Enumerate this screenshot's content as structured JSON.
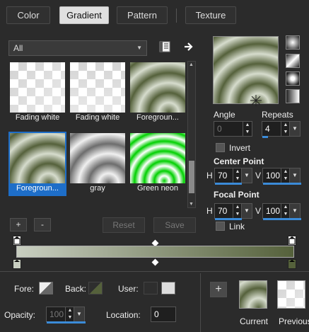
{
  "tabs": [
    {
      "label": "Color"
    },
    {
      "label": "Gradient"
    },
    {
      "label": "Pattern"
    },
    {
      "label": "Texture"
    }
  ],
  "filter": {
    "selected": "All"
  },
  "gallery": [
    {
      "label": "Fading white"
    },
    {
      "label": "Fading white"
    },
    {
      "label": "Foregroun..."
    },
    {
      "label": "Foregroun..."
    },
    {
      "label": "gray"
    },
    {
      "label": "Green neon"
    }
  ],
  "buttons": {
    "add": "+",
    "remove": "-",
    "reset": "Reset",
    "save": "Save"
  },
  "angle": {
    "label": "Angle",
    "value": "0"
  },
  "repeats": {
    "label": "Repeats",
    "value": "4",
    "fraction": 0.04
  },
  "invert": {
    "label": "Invert",
    "checked": false
  },
  "center_point": {
    "label": "Center Point",
    "h_label": "H",
    "h_value": "70",
    "v_label": "V",
    "v_value": "100",
    "h_fraction": 0.7,
    "v_fraction": 1.0
  },
  "focal_point": {
    "label": "Focal Point",
    "h_label": "H",
    "h_value": "70",
    "v_label": "V",
    "v_value": "100",
    "h_fraction": 0.7,
    "v_fraction": 1.0
  },
  "link": {
    "label": "Link",
    "checked": false
  },
  "gradient_colors": {
    "start": "#c9cfc1",
    "end": "#55613b"
  },
  "footer": {
    "fore_label": "Fore:",
    "back_label": "Back:",
    "user_label": "User:",
    "opacity_label": "Opacity:",
    "opacity_value": "100",
    "location_label": "Location:",
    "location_value": "0",
    "add_button": "+",
    "current_label": "Current",
    "previous_label": "Previous"
  }
}
